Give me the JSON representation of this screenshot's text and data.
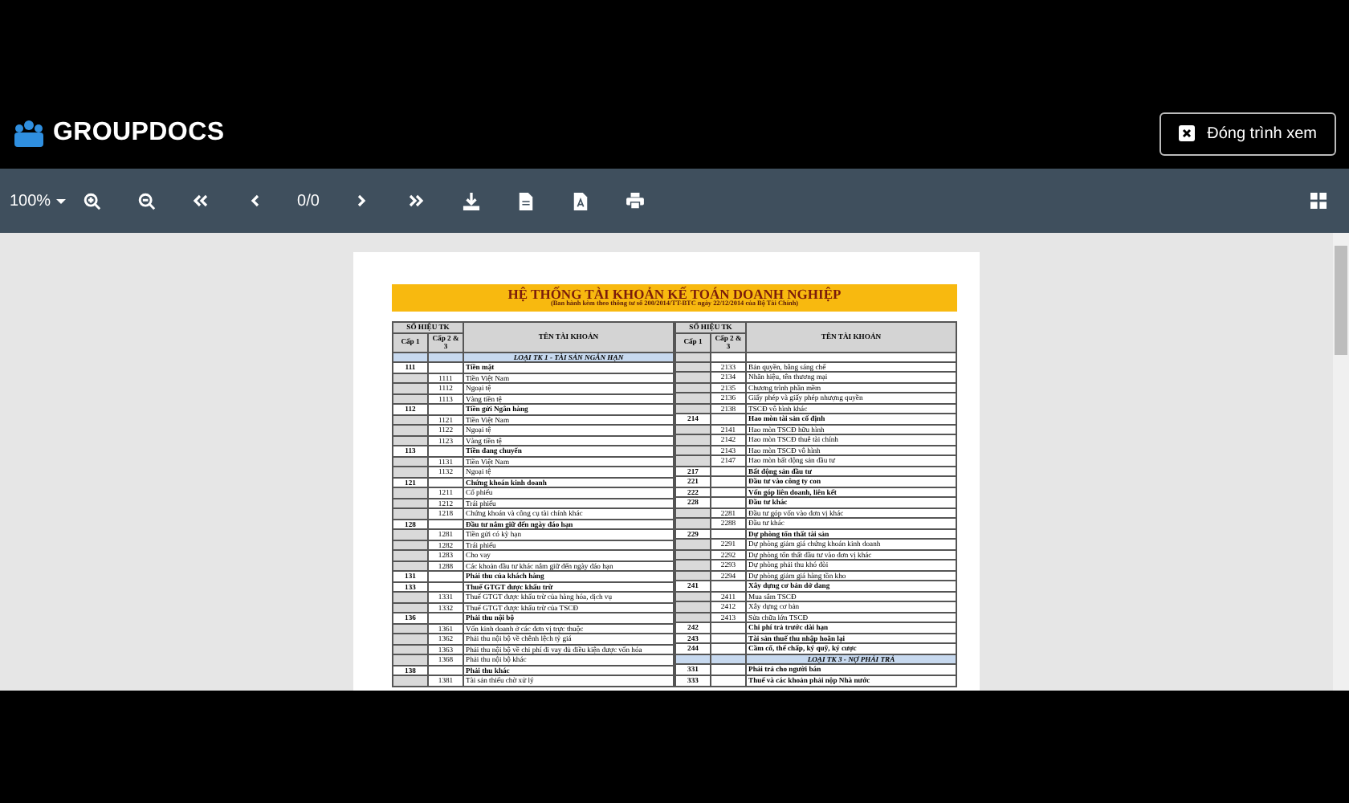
{
  "header": {
    "logo": "GROUPDOCS",
    "close_button": "Đóng trình xem"
  },
  "toolbar": {
    "zoom": "100%",
    "page_counter": "0/0"
  },
  "document": {
    "title": "HỆ THỐNG TÀI KHOẢN KẾ TOÁN DOANH NGHIỆP",
    "subtitle": "(Ban hành kèm theo thông tư số 200/2014/TT-BTC ngày 22/12/2014 của Bộ Tài Chính)",
    "tables": [
      {
        "header": {
          "group": "SỐ HIỆU TK",
          "level1": "Cấp 1",
          "level2": "Cấp 2 & 3",
          "name": "TÊN TÀI KHOẢN"
        },
        "rows": [
          {
            "kind": "section",
            "name": "LOẠI TK 1 - TÀI SẢN NGẮN HẠN"
          },
          {
            "kind": "account",
            "code": "111",
            "name": "Tiền mặt"
          },
          {
            "kind": "sub",
            "code": "1111",
            "name": "Tiền Việt Nam"
          },
          {
            "kind": "sub",
            "code": "1112",
            "name": "Ngoại tệ"
          },
          {
            "kind": "sub",
            "code": "1113",
            "name": "Vàng tiền tệ"
          },
          {
            "kind": "account",
            "code": "112",
            "name": "Tiền gửi Ngân hàng"
          },
          {
            "kind": "sub",
            "code": "1121",
            "name": "Tiền Việt Nam"
          },
          {
            "kind": "sub",
            "code": "1122",
            "name": "Ngoại tệ"
          },
          {
            "kind": "sub",
            "code": "1123",
            "name": "Vàng tiền tệ"
          },
          {
            "kind": "account",
            "code": "113",
            "name": "Tiền đang chuyển"
          },
          {
            "kind": "sub",
            "code": "1131",
            "name": "Tiền Việt Nam"
          },
          {
            "kind": "sub",
            "code": "1132",
            "name": "Ngoại tệ"
          },
          {
            "kind": "account",
            "code": "121",
            "name": "Chứng khoán kinh doanh"
          },
          {
            "kind": "sub",
            "code": "1211",
            "name": "Cổ phiếu"
          },
          {
            "kind": "sub",
            "code": "1212",
            "name": "Trái phiếu"
          },
          {
            "kind": "sub",
            "code": "1218",
            "name": "Chứng khoán và công cụ tài chính khác"
          },
          {
            "kind": "account",
            "code": "128",
            "name": "Đầu tư nắm giữ đến ngày đáo hạn"
          },
          {
            "kind": "sub",
            "code": "1281",
            "name": "Tiền gửi có kỳ hạn"
          },
          {
            "kind": "sub",
            "code": "1282",
            "name": "Trái phiếu"
          },
          {
            "kind": "sub",
            "code": "1283",
            "name": "Cho vay"
          },
          {
            "kind": "sub",
            "code": "1288",
            "name": "Các khoản đầu tư khác nắm giữ đến ngày đáo hạn"
          },
          {
            "kind": "account",
            "code": "131",
            "name": "Phải thu của khách hàng"
          },
          {
            "kind": "account",
            "code": "133",
            "name": "Thuế GTGT được khấu trừ"
          },
          {
            "kind": "sub",
            "code": "1331",
            "name": "Thuế GTGT được khấu trừ của hàng hóa, dịch vụ"
          },
          {
            "kind": "sub",
            "code": "1332",
            "name": "Thuế GTGT được khấu trừ của TSCĐ"
          },
          {
            "kind": "account",
            "code": "136",
            "name": "Phải thu nội bộ"
          },
          {
            "kind": "sub",
            "code": "1361",
            "name": "Vốn kinh doanh ở các đơn vị trực thuộc"
          },
          {
            "kind": "sub",
            "code": "1362",
            "name": "Phải thu nội bộ về chênh lệch tỷ giá"
          },
          {
            "kind": "sub",
            "code": "1363",
            "name": "Phải thu nội bộ về chi phí đi vay đủ điều kiện được vốn hóa"
          },
          {
            "kind": "sub",
            "code": "1368",
            "name": "Phải thu nội bộ khác"
          },
          {
            "kind": "account",
            "code": "138",
            "name": "Phải thu khác"
          },
          {
            "kind": "sub",
            "code": "1381",
            "name": "Tài sản thiếu chờ xử lý"
          }
        ]
      },
      {
        "header": {
          "group": "SỐ HIỆU TK",
          "level1": "Cấp 1",
          "level2": "Cấp 2 & 3",
          "name": "TÊN TÀI KHOẢN"
        },
        "rows": [
          {
            "kind": "blank"
          },
          {
            "kind": "sub",
            "code": "2133",
            "name": "Bản quyền, bằng sáng chế"
          },
          {
            "kind": "sub",
            "code": "2134",
            "name": "Nhãn hiệu, tên thương mại"
          },
          {
            "kind": "sub",
            "code": "2135",
            "name": "Chương trình phần mềm"
          },
          {
            "kind": "sub",
            "code": "2136",
            "name": "Giấy phép và giấy phép nhượng quyền"
          },
          {
            "kind": "sub",
            "code": "2138",
            "name": "TSCĐ vô hình khác"
          },
          {
            "kind": "account",
            "code": "214",
            "name": "Hao mòn tài sản cố định"
          },
          {
            "kind": "sub",
            "code": "2141",
            "name": "Hao mòn TSCĐ hữu hình"
          },
          {
            "kind": "sub",
            "code": "2142",
            "name": "Hao mòn TSCĐ thuê tài chính"
          },
          {
            "kind": "sub",
            "code": "2143",
            "name": "Hao mòn TSCĐ vô hình"
          },
          {
            "kind": "sub",
            "code": "2147",
            "name": "Hao mòn bất động sản đầu tư"
          },
          {
            "kind": "account",
            "code": "217",
            "name": "Bất động sản đầu tư"
          },
          {
            "kind": "account",
            "code": "221",
            "name": "Đầu tư vào công ty con"
          },
          {
            "kind": "account",
            "code": "222",
            "name": "Vốn góp liên doanh, liên kết"
          },
          {
            "kind": "account",
            "code": "228",
            "name": "Đầu tư khác"
          },
          {
            "kind": "sub",
            "code": "2281",
            "name": "Đầu tư góp vốn vào đơn vị khác"
          },
          {
            "kind": "sub",
            "code": "2288",
            "name": "Đầu tư khác"
          },
          {
            "kind": "account",
            "code": "229",
            "name": "Dự phòng tổn thất tài sản"
          },
          {
            "kind": "sub",
            "code": "2291",
            "name": "Dự phòng giảm giá chứng khoán kinh doanh"
          },
          {
            "kind": "sub",
            "code": "2292",
            "name": "Dự phòng tổn thất đầu tư vào đơn vị khác"
          },
          {
            "kind": "sub",
            "code": "2293",
            "name": "Dự phòng phải thu khó đòi"
          },
          {
            "kind": "sub",
            "code": "2294",
            "name": "Dự phòng giảm giá hàng tồn kho"
          },
          {
            "kind": "account",
            "code": "241",
            "name": "Xây dựng cơ bản dở dang"
          },
          {
            "kind": "sub",
            "code": "2411",
            "name": "Mua sắm TSCĐ"
          },
          {
            "kind": "sub",
            "code": "2412",
            "name": "Xây dựng cơ bản"
          },
          {
            "kind": "sub",
            "code": "2413",
            "name": "Sửa chữa lớn TSCĐ"
          },
          {
            "kind": "account",
            "code": "242",
            "name": "Chi phí trả trước dài hạn"
          },
          {
            "kind": "account",
            "code": "243",
            "name": "Tài sản thuế thu nhập hoãn lại"
          },
          {
            "kind": "account",
            "code": "244",
            "name": "Cầm cố, thế chấp, ký quỹ, ký cược"
          },
          {
            "kind": "section",
            "name": "LOẠI TK 3 - NỢ PHẢI TRẢ"
          },
          {
            "kind": "account",
            "code": "331",
            "name": "Phải trả cho người bán"
          },
          {
            "kind": "account",
            "code": "333",
            "name": "Thuế và các khoản phải nộp Nhà nước"
          }
        ]
      }
    ]
  }
}
